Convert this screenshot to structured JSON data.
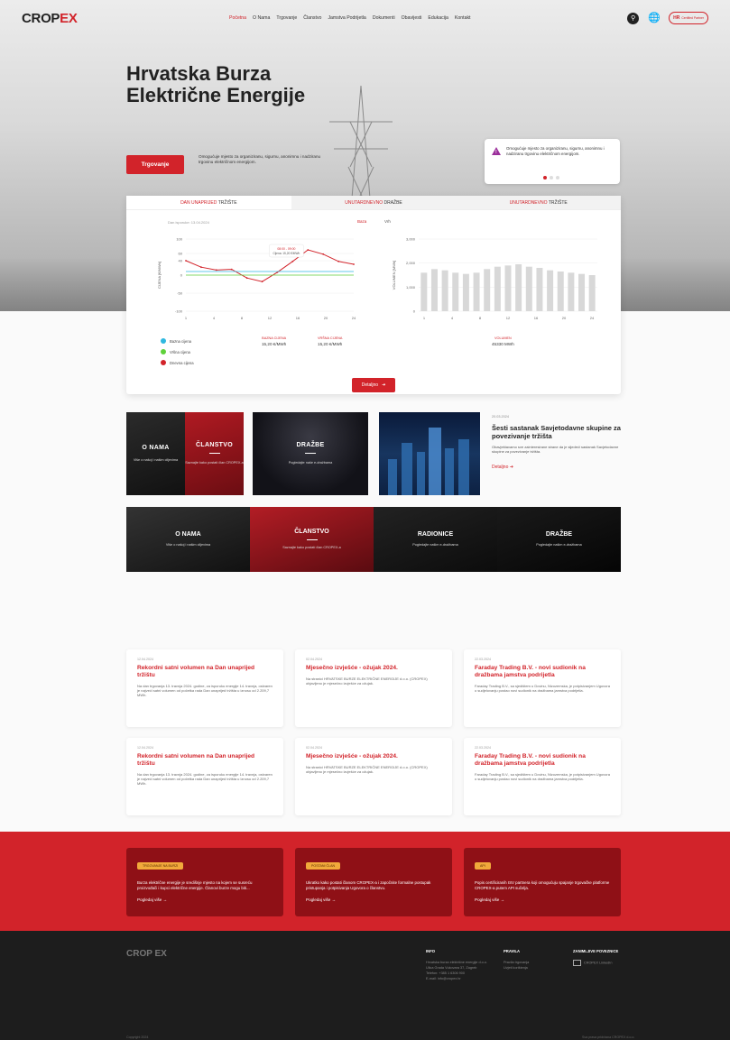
{
  "header": {
    "logo_a": "CROP",
    "logo_b": "EX",
    "nav": [
      "Početna",
      "O Nama",
      "Trgovanje",
      "Članstvo",
      "Jamstva Podrijetla",
      "Dokumenti",
      "Obavijesti",
      "Edukacija",
      "Kontakt"
    ],
    "partner_logo": "HR",
    "partner_text": "Certified Partner"
  },
  "hero": {
    "title": "Hrvatska Burza Električne Energije",
    "button": "Trgovanje",
    "text": "Omogućuje mjesto za organiziranu, sigurnu, anonimnu i nadziranu trgovinu električnom energijom.",
    "alert_text": "Omogućuje mjesto za organiziranu, sigurnu, anonimnu i nadziranu trgovinu električnom energijom."
  },
  "market": {
    "tabs": [
      {
        "red": "DAN UNAPRIJED",
        "dark": "TRŽIŠTE"
      },
      {
        "red": "UNUTARDNEVNO",
        "dark": "DRAŽBE"
      },
      {
        "red": "UNUTARDNEVNO",
        "dark": "TRŽIŠTE"
      }
    ],
    "date": "Dan isporuke: 13.04.2024",
    "toggle_a": "Baza",
    "toggle_b": "Vrh",
    "legend": [
      "Bazna cijena",
      "Vršna cijena",
      "Dnevna cijena"
    ],
    "stat1_label": "BAZNA CIJENA",
    "stat1_value": "15,20 €/MWh",
    "stat2_label": "VRŠNA CIJENA",
    "stat2_value": "15,20 €/MWh",
    "stat3_label": "VOLUMEN",
    "stat3_value": "45330 MWh",
    "more": "Detaljno"
  },
  "chart_data": [
    {
      "type": "line",
      "ylabel": "CIJENA [€/MWh]",
      "x": [
        1,
        4,
        8,
        12,
        16,
        20,
        24
      ],
      "ylim": [
        -100,
        100
      ],
      "yticks": [
        100,
        60,
        40,
        0,
        -50,
        -100
      ],
      "series": [
        {
          "name": "Dnevna cijena",
          "values": [
            40,
            22,
            14,
            16,
            -8,
            -18,
            8,
            38,
            70,
            58,
            38,
            30
          ]
        },
        {
          "name": "Bazna cijena",
          "values": [
            10,
            10,
            10,
            10,
            10,
            10,
            10,
            10,
            10,
            10,
            10,
            10
          ]
        },
        {
          "name": "Vršna cijena",
          "values": [
            0,
            0,
            0,
            0,
            0,
            0,
            0,
            0,
            0,
            0,
            0,
            0
          ]
        }
      ],
      "tooltip_title": "08:00 - 09:00",
      "tooltip_text": "Cijena: 15,20 €/MWh"
    },
    {
      "type": "bar",
      "ylabel": "VOLUMEN [MWh]",
      "x": [
        1,
        4,
        8,
        12,
        16,
        20,
        24
      ],
      "ylim": [
        0,
        3000
      ],
      "yticks": [
        3000,
        2000,
        1000,
        0
      ],
      "values": [
        1600,
        1750,
        1700,
        1600,
        1550,
        1600,
        1750,
        1850,
        1900,
        1950,
        1850,
        1800,
        1700,
        1650,
        1600,
        1550,
        1500
      ]
    }
  ],
  "cards": {
    "c1a_title": "O NAMA",
    "c1a_sub": "Više o našoj i našim ciljevima",
    "c1b_title": "ČLANSTVO",
    "c1b_sub": "Saznajte kako postati član CROPEX-a",
    "c2_title": "DRAŽBE",
    "c2_sub": "Pogledajte naše e-dražbama",
    "news_date": "20.03.2024",
    "news_title": "Šesti sastanak Savjetodavne skupine za povezivanje tržišta",
    "news_text": "Obavještavamo sve zainteresirane strane da je sljedeći sastanak Savjetodavne skupine za povezivanje tržišta.",
    "news_more": "Detaljno"
  },
  "row2": [
    {
      "title": "O NAMA",
      "sub": "Više o našoj i našim ciljevima"
    },
    {
      "title": "ČLANSTVO",
      "sub": "Saznajte kako postati član CROPEX-a"
    },
    {
      "title": "RADIONICE",
      "sub": "Pogledajte našim e-dražbama"
    },
    {
      "title": "DRAŽBE",
      "sub": "Pogledajte našim e-dražbama"
    }
  ],
  "news": [
    {
      "date": "12.04.2024",
      "title": "Rekordni satni volumen na Dan unaprijed tržištu",
      "text": "Na dan trgovanja 13. travnja 2024. godine, za isporuku energije 14. travnja, ostvaren je najveći satni volumen od početka rada Dan unaprijed tržišta u iznosu od 2.209,7 MWh."
    },
    {
      "date": "02.04.2024",
      "title": "Mjesečno izvješće - ožujak 2024.",
      "text": "Na stranici HRVATSKE BURZE ELEKTRIČNE ENERGIJE d.o.o. (CROPEX) objavljeno je mjesečno izvješće za ožujak."
    },
    {
      "date": "22.03.2024",
      "title": "Faraday Trading B.V. - novi sudionik na dražbama jamstva podrijetla",
      "text": "Faraday Trading B.V., sa sjedištem u Dovinu, Nizozemska, je potpisivanjem Ugovora o sudjelovanju postao novi sudionik na dražbama jamstva podrijetla."
    },
    {
      "date": "12.04.2024",
      "title": "Rekordni satni volumen na Dan unaprijed tržištu",
      "text": "Na dan trgovanja 13. travnja 2024. godine, za isporuku energije 14. travnja, ostvaren je najveći satni volumen od početka rada Dan unaprijed tržišta u iznosu od 2.209,7 MWh."
    },
    {
      "date": "02.04.2024",
      "title": "Mjesečno izvješće - ožujak 2024.",
      "text": "Na stranici HRVATSKE BURZE ELEKTRIČNE ENERGIJE d.o.o. (CROPEX) objavljeno je mjesečno izvješće za ožujak."
    },
    {
      "date": "22.03.2024",
      "title": "Faraday Trading B.V. - novi sudionik na dražbama jamstva podrijetla",
      "text": "Faraday Trading B.V., sa sjedištem u Dovinu, Nizozemska, je potpisivanjem Ugovora o sudjelovanju postao novi sudionik na dražbama jamstva podrijetla."
    }
  ],
  "band": [
    {
      "tag": "TRGOVANJE NA BURZI",
      "text": "Burza električne energije je središnje mjesto na kojem se susreću proizvođači i kupci električne energije. Članovi burze mogu biti...",
      "more": "Pogledaj više"
    },
    {
      "tag": "POSTANI ČLAN",
      "text": "Ukratko kako postati članom CROPEX-a i započnite formalne postupak pristupanja i potpisivanja Ugovora o članstvu.",
      "more": "Pogledaj više"
    },
    {
      "tag": "API",
      "text": "Popis certificiranih ISV partnera koji omogućuju spajanje trgovačke platforme CROPEX-a putem API sučelja.",
      "more": "Pogledaj više"
    }
  ],
  "footer": {
    "logo": "CROP EX",
    "info_h": "INFO",
    "info": [
      "Hrvatska burza električne energije d.o.o.",
      "Ulica Grada Vukovara 37, Zagreb",
      "Telefon: +385 1 6306 900",
      "E-mail: info@cropex.hr"
    ],
    "pravila_h": "PRAVILA",
    "pravila": [
      "Pravila trgovanja",
      "Uvjeti korištenja"
    ],
    "links_h": "ZANIMLJIVE POVEZNICE",
    "links": [
      "CROPEX LinkedIn"
    ],
    "copy": "Copyright 2024",
    "copy2": "Sva prava pridržana CROPEX d.o.o."
  },
  "colors": {
    "brand": "#d2232a",
    "dark": "#1d1d1d",
    "band": "#d2232a",
    "tag": "#f1a93b"
  }
}
